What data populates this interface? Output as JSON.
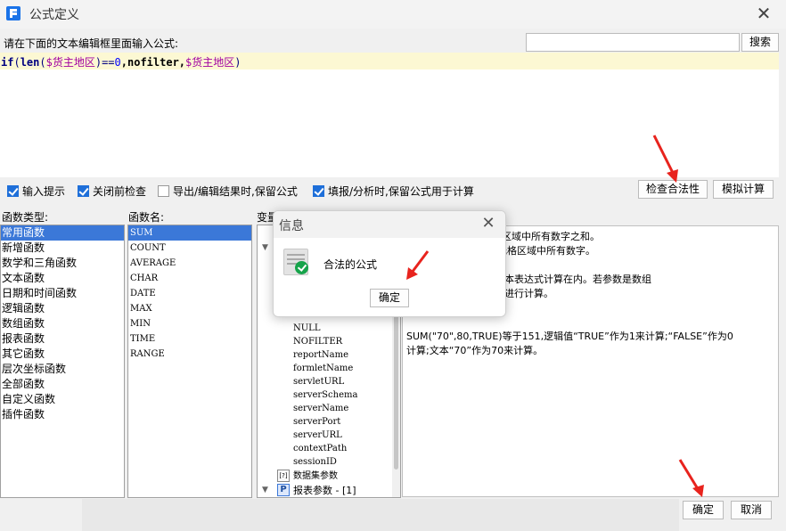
{
  "window": {
    "title": "公式定义",
    "close_icon": "close-icon"
  },
  "editor": {
    "prompt": "请在下面的文本编辑框里面输入公式:",
    "search_placeholder": "",
    "search_label": "搜索",
    "formula_tokens": [
      {
        "t": "if",
        "c": "kw"
      },
      {
        "t": "(",
        "c": "pn"
      },
      {
        "t": "len",
        "c": "kw"
      },
      {
        "t": "(",
        "c": "pn"
      },
      {
        "t": "$货主地区",
        "c": "var"
      },
      {
        "t": ")",
        "c": "pn"
      },
      {
        "t": "==",
        "c": "pn"
      },
      {
        "t": "0",
        "c": "num"
      },
      {
        "t": ",nofilter,",
        "c": "plain"
      },
      {
        "t": "$货主地区",
        "c": "var"
      },
      {
        "t": ")",
        "c": "pn"
      }
    ]
  },
  "options": {
    "input_hint": {
      "label": "输入提示",
      "checked": true
    },
    "check_before_close": {
      "label": "关闭前检查",
      "checked": true
    },
    "keep_formula_export": {
      "label": "导出/编辑结果时,保留公式",
      "checked": false
    },
    "keep_formula_fill": {
      "label": "填报/分析时,保留公式用于计算",
      "checked": true
    },
    "check_validity_label": "检查合法性",
    "simulate_label": "模拟计算"
  },
  "columns": {
    "func_type_label": "函数类型:",
    "func_name_label": "函数名:",
    "var_label": "变量"
  },
  "func_types": [
    "常用函数",
    "新增函数",
    "数学和三角函数",
    "文本函数",
    "日期和时间函数",
    "逻辑函数",
    "数组函数",
    "报表函数",
    "其它函数",
    "层次坐标函数",
    "全部函数",
    "自定义函数",
    "插件函数"
  ],
  "func_names": [
    "SUM",
    "COUNT",
    "AVERAGE",
    "CHAR",
    "DATE",
    "MAX",
    "MIN",
    "TIME",
    "RANGE"
  ],
  "variables": {
    "items": [
      "NULL",
      "NOFILTER",
      "reportName",
      "formletName",
      "servletURL",
      "serverSchema",
      "serverName",
      "serverPort",
      "serverURL",
      "contextPath",
      "sessionID"
    ],
    "dataset_params": "数据集参数",
    "report_params": "报表参数 - [1]"
  },
  "description": {
    "lines": [
      "…):求一个指定单元格区域中所有数字之和。",
      "1到n个参数或指定单元格区域中所有数字。",
      "",
      "中的数值、逻辑值及文本表达式计算在内。若参数是数组",
      "或单元格引用中的数值进行计算。",
      "",
      "",
      "SUM(\"70\",80,TRUE)等于151,逻辑值“TRUE”作为1来计算;“FALSE”作为0",
      "计算;文本“70”作为70来计算。"
    ]
  },
  "footer": {
    "ok_label": "确定",
    "cancel_label": "取消"
  },
  "modal": {
    "title": "信息",
    "message": "合法的公式",
    "ok_label": "确定",
    "status_icon": "success-check-icon"
  },
  "colors": {
    "accent": "#3b78d8",
    "highlight_line": "#fcf8d3",
    "annotation": "#e8231d",
    "success": "#16a34a"
  }
}
